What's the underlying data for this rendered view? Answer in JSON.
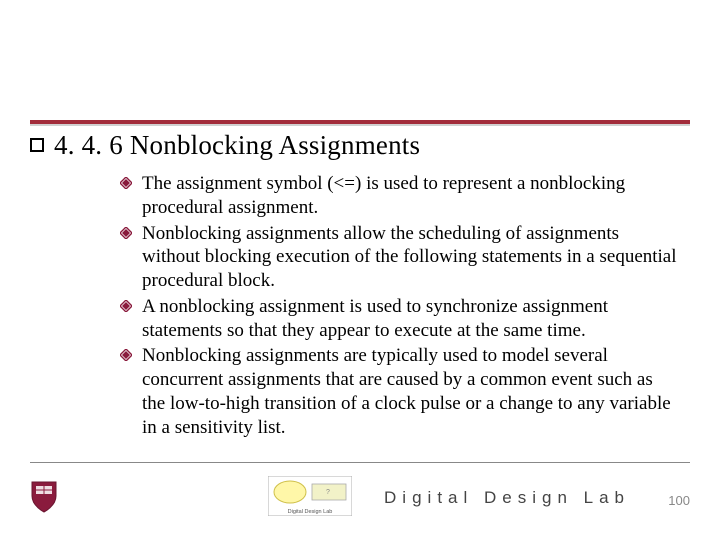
{
  "title": "4. 4. 6 Nonblocking Assignments",
  "bullets": [
    "The assignment symbol (<=) is used to represent a nonblocking procedural assignment.",
    "Nonblocking assignments allow the scheduling of assignments without blocking execution of the following statements in a sequential procedural block.",
    "A nonblocking assignment is used to synchronize assignment statements so that they appear to execute at the same time.",
    "Nonblocking assignments are typically used to model several concurrent assignments that are caused by a common event such as the low-to-high transition of a clock pulse or a change to any variable in a sensitivity list."
  ],
  "footer": {
    "label": "Digital Design Lab",
    "page": "100",
    "center_logo_caption": "Digital Design Lab"
  },
  "colors": {
    "accent": "#a22c3b",
    "shield": "#8a1b3d",
    "text": "#000000"
  }
}
